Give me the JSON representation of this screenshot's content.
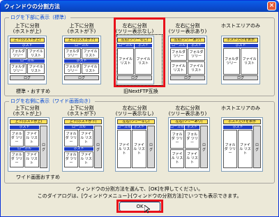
{
  "window": {
    "title": "ウィンドウの分割方法",
    "close_label": "×"
  },
  "group_top": {
    "label": "ログを下部に表示（標準）",
    "note_standard": "標準・おすすめ",
    "note_nextftp": "旧NextFTP互換",
    "options": [
      {
        "caption": [
          "上下に分割",
          "(ホストが上)"
        ],
        "top_bar": "上下(ホストが上)",
        "rows": [
          "ホスト",
          "フォルダ ツリー",
          "ファイル リスト",
          "ローカル",
          "フォルダ ツリー",
          "ファイル リスト"
        ],
        "log": "ログ"
      },
      {
        "caption": [
          "上下に分割",
          "(ホストが下)"
        ],
        "top_bar": "上下(ホストが下)",
        "rows": [
          "ローカル",
          "フォルダ ツリー",
          "ファイル リスト",
          "ホスト",
          "フォルダ ツリー",
          "ファイル リスト"
        ],
        "log": "ログ"
      },
      {
        "caption": [
          "左右に分割",
          "(ツリー表示なし)"
        ],
        "top_bar": "左右(ツリーなし)",
        "rows": [
          "ローカル",
          "ホスト",
          "ファイル リスト",
          "ファイル リスト"
        ],
        "log": "ログ"
      },
      {
        "caption": [
          "左右に分割",
          "(ツリー表示あり)"
        ],
        "top_bar": "左右(ツリーあり)",
        "rows": [
          "ローカル",
          "ホスト",
          "フォルダ ツリー",
          "ファイル リスト",
          "フォルダ ツリー",
          "ファイル リスト"
        ],
        "log": "ログ"
      },
      {
        "caption": [
          "ホストエリアのみ",
          ""
        ],
        "top_bar": "ホストだけを表示",
        "rows": [
          "ホスト",
          "フォルダ ツリー",
          "ファイル リスト"
        ],
        "log": "ログ"
      }
    ]
  },
  "group_right": {
    "label": "ログを右側に表示（ワイド画面向き）",
    "note_wide": "ワイド画面おすすめ",
    "options": [
      {
        "caption": [
          "上下に分割",
          "(ホストが上)"
        ],
        "top_bar": "上下(ホストが上)",
        "rows": [
          "ホスト",
          "フォルダ ツリー",
          "ファイル リスト",
          "ローカル",
          "フォルダ ツリー",
          "ファイル リスト"
        ],
        "log": "ログ"
      },
      {
        "caption": [
          "上下に分割",
          "(ホストが下)"
        ],
        "top_bar": "上下(ホストが下)",
        "rows": [
          "ローカル",
          "フォルダ ツリー",
          "ファイル リスト",
          "ホスト",
          "フォルダ ツリー",
          "ファイル リスト"
        ],
        "log": "ログ"
      },
      {
        "caption": [
          "左右に分割",
          "(ツリー表示なし)"
        ],
        "top_bar": "左右(ツリーなし)",
        "rows": [
          "ローカル",
          "ホスト",
          "ファイル リスト",
          "ファイル リスト"
        ],
        "log": "ログ"
      },
      {
        "caption": [
          "左右に分割",
          "(ツリー表示あり)"
        ],
        "top_bar": "左右(ツリーあり)",
        "rows": [
          "ローカル",
          "ホスト",
          "フォルダ ツリー",
          "ファイル リスト",
          "フォルダ ツリー",
          "ファイル リスト"
        ],
        "log": "ログ"
      },
      {
        "caption": [
          "ホストエリアのみ",
          ""
        ],
        "top_bar": "ホストだけを表示",
        "rows": [
          "ホスト",
          "フォルダ ツリー",
          "ファイル リスト"
        ],
        "log": "ログ"
      }
    ]
  },
  "instruction": {
    "line1": "ウィンドウの分割方法を選んで、[OK]を押してください。",
    "line2": "このダイアログは、[ウィンドウメニュー]-[ウィンドウの分割方法]でいつでも表示できます。"
  },
  "ok_label": "OK",
  "colors": {
    "highlight": "#e8101a",
    "pane_header": "#1f3fc9",
    "title_bar": "#0a5fe8"
  }
}
